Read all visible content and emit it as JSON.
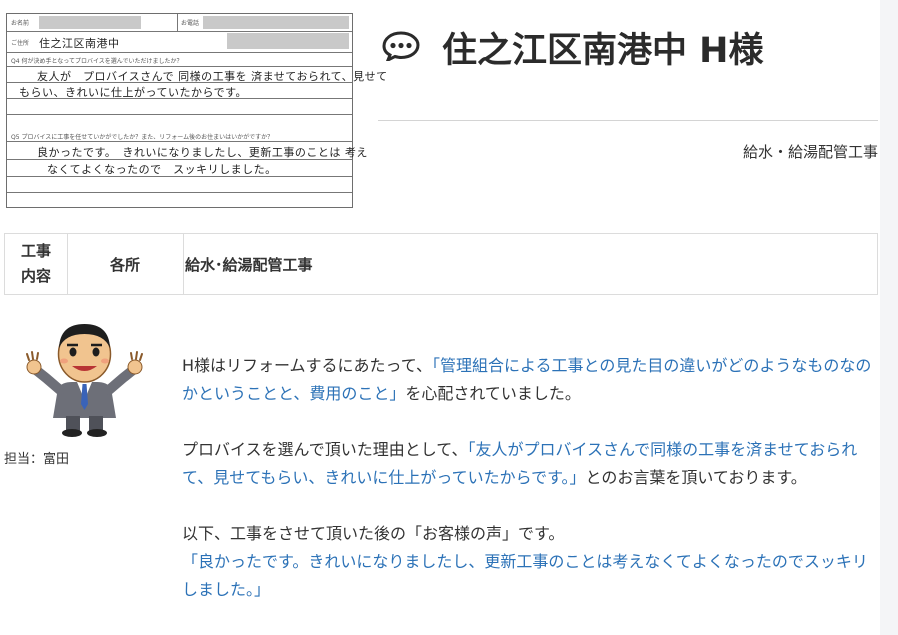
{
  "form_image": {
    "name_label": "お名前",
    "phone_label": "お電話",
    "address_label": "ご住所",
    "address_handwritten": "住之江区南港中",
    "q4_label": "Q4 何が決め手となってプロバイスを選んでいただけましたか？",
    "q4_line1": "友人が　プロバイスさんで 同様の工事を 済ませておられて、見せて",
    "q4_line2": "もらい、きれいに仕上がっていたからです。",
    "q5_label": "Q5 プロバイスに工事を任せていかがでしたか？また、リフォーム後のお住まいはいかがですか？",
    "q5_line1": "良かったです。　きれいになりましたし、更新工事のことは 考え",
    "q5_line2": "なくてよくなったので　スッキリしました。"
  },
  "header": {
    "title_icon": "speech-bubble-icon",
    "title": "住之江区南港中 H様",
    "category": "給水・給湯配管工事"
  },
  "work_table": {
    "label_line1": "工事",
    "label_line2": "内容",
    "location": "各所",
    "description": "給水･給湯配管工事"
  },
  "staff": {
    "label": "担当：富田"
  },
  "content": {
    "p1_pre": "H様はリフォームするにあたって、",
    "p1_quote": "「管理組合による工事との見た目の違いがどのようなものなのかということと、費用のこと」",
    "p1_post": "を心配されていました。",
    "p2_pre": "プロバイスを選んで頂いた理由として、",
    "p2_quote": "「友人がプロバイスさんで同様の工事を済ませておられて、見せてもらい、きれいに仕上がっていたからです。」",
    "p2_post": "とのお言葉を頂いております。",
    "p3_line1": "以下、工事をさせて頂いた後の「お客様の声」です。",
    "p3_quote": "「良かったです。きれいになりましたし、更新工事のことは考えなくてよくなったのでスッキリしました。」"
  },
  "colors": {
    "accent_blue": "#2c72b7",
    "title_text": "#2b2b2b"
  }
}
